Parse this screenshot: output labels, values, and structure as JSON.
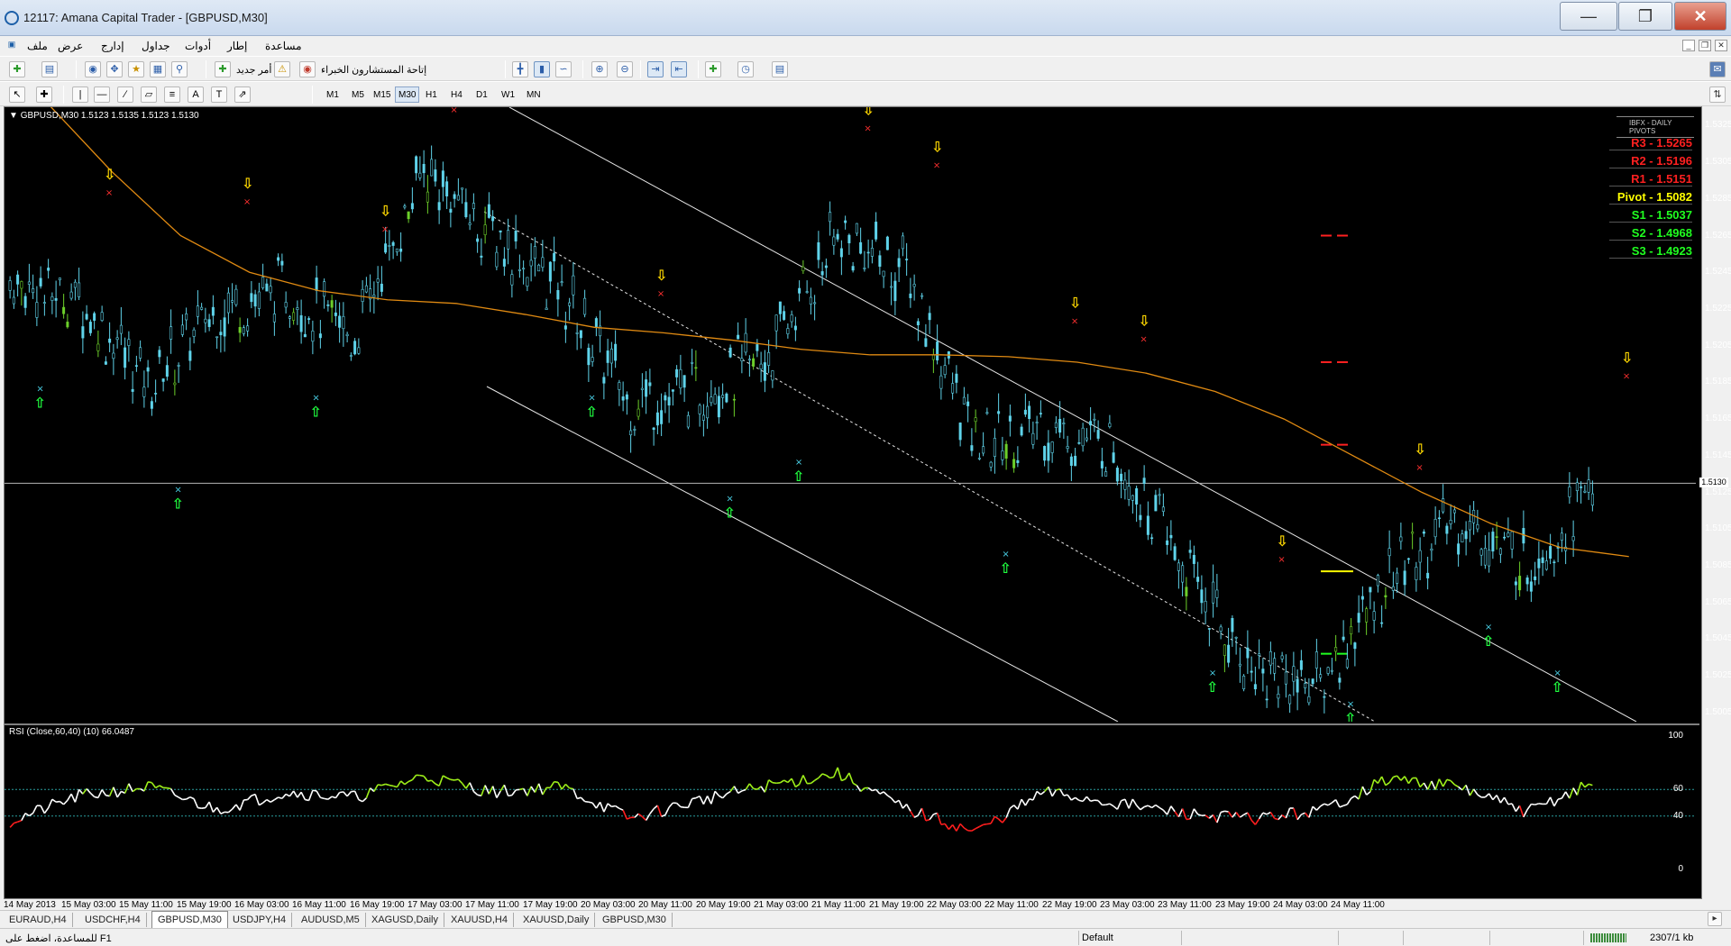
{
  "window": {
    "title": "12117: Amana Capital Trader - [GBPUSD,M30]"
  },
  "menu": [
    "ملف",
    "عرض",
    "إدارج",
    "جداول",
    "أدوات",
    "إطار",
    "مساعدة"
  ],
  "toolbar": {
    "new_order_label": "أمر جديد",
    "experts_label": "إتاحة المستشارون الخبراء"
  },
  "timeframes": [
    "M1",
    "M5",
    "M15",
    "M30",
    "H1",
    "H4",
    "D1",
    "W1",
    "MN"
  ],
  "active_timeframe": "M30",
  "chart": {
    "symbol_info": "GBPUSD,M30  1.5123 1.5135 1.5123 1.5130",
    "current_price_tag": "1.5130",
    "rsi_label": "RSI (Close,60,40) (10) 66.0487"
  },
  "pivots": {
    "header": "IBFX - DAILY PIVOTS",
    "rows": [
      {
        "label": "R3 - 1.5265",
        "color": "#ff2020"
      },
      {
        "label": "R2 - 1.5196",
        "color": "#ff2020"
      },
      {
        "label": "R1 - 1.5151",
        "color": "#ff2020"
      },
      {
        "label": "Pivot - 1.5082",
        "color": "#ffff00"
      },
      {
        "label": "S1 - 1.5037",
        "color": "#20ff20"
      },
      {
        "label": "S2 - 1.4968",
        "color": "#20ff20"
      },
      {
        "label": "S3 - 1.4923",
        "color": "#20ff20"
      }
    ]
  },
  "price_axis": [
    "1.5325",
    "1.5305",
    "1.5285",
    "1.5265",
    "1.5245",
    "1.5225",
    "1.5205",
    "1.5185",
    "1.5165",
    "1.5145",
    "1.5125",
    "1.5105",
    "1.5085",
    "1.5065",
    "1.5045",
    "1.5025",
    "1.5005"
  ],
  "rsi_axis": [
    "100",
    "60",
    "40",
    "0"
  ],
  "time_axis": [
    "14 May 2013",
    "15 May 03:00",
    "15 May 11:00",
    "15 May 19:00",
    "16 May 03:00",
    "16 May 11:00",
    "16 May 19:00",
    "17 May 03:00",
    "17 May 11:00",
    "17 May 19:00",
    "20 May 03:00",
    "20 May 11:00",
    "20 May 19:00",
    "21 May 03:00",
    "21 May 11:00",
    "21 May 19:00",
    "22 May 03:00",
    "22 May 11:00",
    "22 May 19:00",
    "23 May 03:00",
    "23 May 11:00",
    "23 May 19:00",
    "24 May 03:00",
    "24 May 11:00"
  ],
  "tabs": [
    "EURAUD,H4",
    "USDCHF,H4",
    "GBPUSD,M30",
    "USDJPY,H4",
    "AUDUSD,M5",
    "XAGUSD,Daily",
    "XAUUSD,H4",
    "XAUUSD,Daily",
    "GBPUSD,M30"
  ],
  "active_tab_index": 2,
  "status": {
    "help": "للمساعدة، اضغط على F1",
    "profile": "Default",
    "traffic": "2307/1 kb"
  },
  "chart_data": {
    "type": "candlestick",
    "symbol": "GBPUSD",
    "timeframe": "M30",
    "ylim": [
      1.5,
      1.5335
    ],
    "x": [
      "14 May 2013",
      "15 May 03:00",
      "15 May 11:00",
      "15 May 19:00",
      "16 May 03:00",
      "16 May 11:00",
      "16 May 19:00",
      "17 May 03:00",
      "17 May 11:00",
      "17 May 19:00",
      "20 May 03:00",
      "20 May 11:00",
      "20 May 19:00",
      "21 May 03:00",
      "21 May 11:00",
      "21 May 19:00",
      "22 May 03:00",
      "22 May 11:00",
      "22 May 19:00",
      "23 May 03:00",
      "23 May 11:00",
      "23 May 19:00",
      "24 May 03:00",
      "24 May 11:00"
    ],
    "close": [
      1.524,
      1.523,
      1.5185,
      1.5225,
      1.5235,
      1.521,
      1.53,
      1.5265,
      1.5235,
      1.5175,
      1.518,
      1.52,
      1.5265,
      1.5245,
      1.515,
      1.516,
      1.515,
      1.5085,
      1.503,
      1.502,
      1.508,
      1.511,
      1.5085,
      1.513
    ],
    "moving_average": [
      1.534,
      1.53,
      1.5265,
      1.5245,
      1.5235,
      1.523,
      1.5228,
      1.5222,
      1.5215,
      1.5212,
      1.5208,
      1.5203,
      1.52,
      1.52,
      1.5199,
      1.5196,
      1.519,
      1.518,
      1.5165,
      1.5145,
      1.5125,
      1.5108,
      1.5095,
      1.509
    ],
    "current_price": 1.513,
    "rsi": {
      "period": 10,
      "levels": [
        60,
        40
      ],
      "ylim": [
        0,
        100
      ],
      "last": 66.0487,
      "values": [
        36,
        55,
        62,
        45,
        58,
        54,
        70,
        58,
        62,
        38,
        52,
        63,
        72,
        45,
        28,
        58,
        50,
        42,
        38,
        44,
        68,
        62,
        43,
        66
      ]
    }
  }
}
